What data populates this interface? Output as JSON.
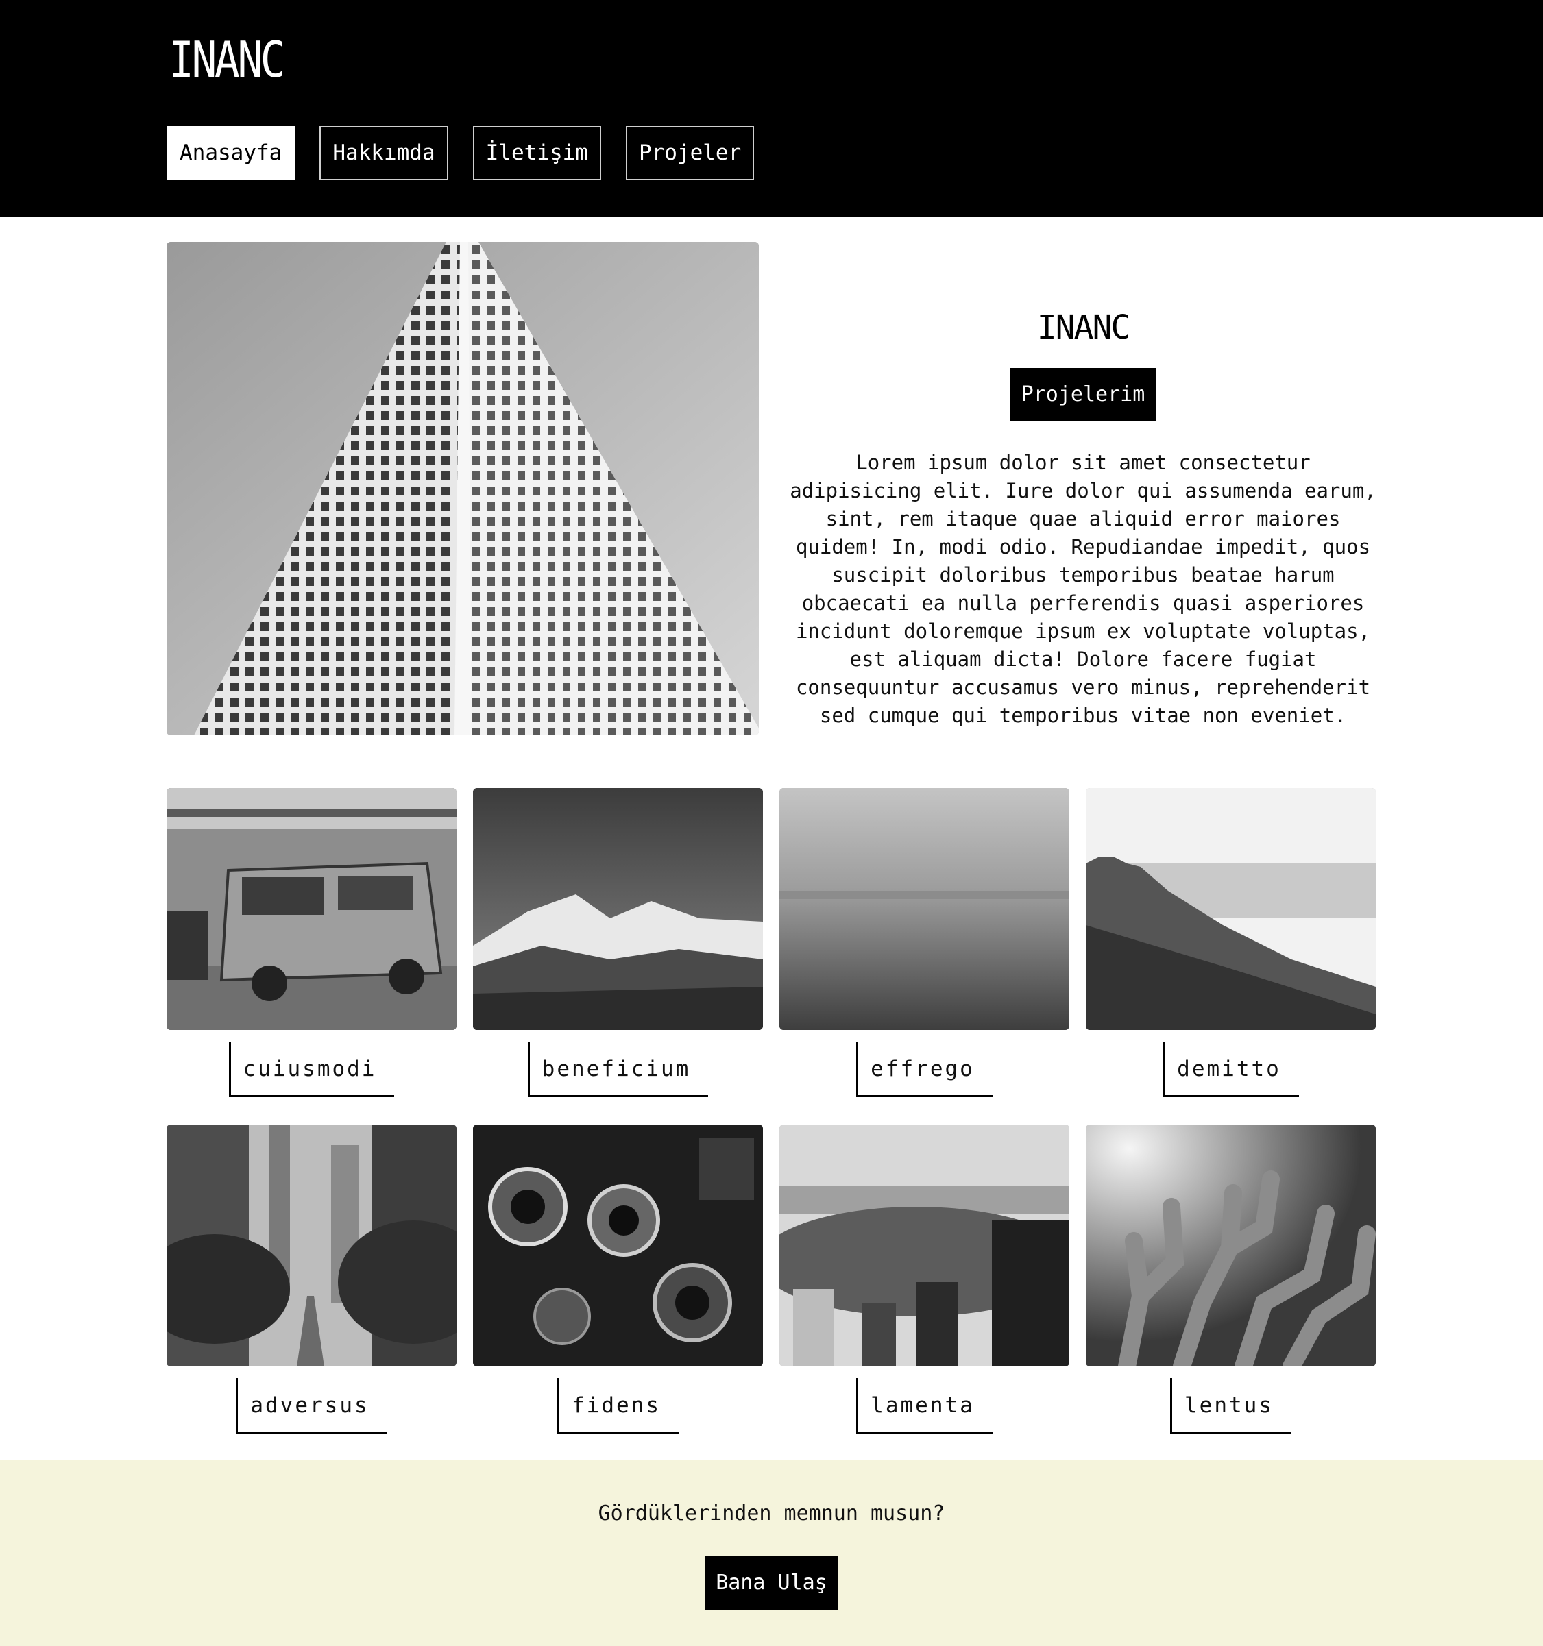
{
  "header": {
    "logo": "INANC",
    "nav": [
      {
        "label": "Anasayfa",
        "active": true
      },
      {
        "label": "Hakkımda",
        "active": false
      },
      {
        "label": "İletişim",
        "active": false
      },
      {
        "label": "Projeler",
        "active": false
      }
    ]
  },
  "hero": {
    "title": "INANC",
    "button_label": "Projelerim",
    "text": "Lorem ipsum dolor sit amet consectetur adipisicing elit. Iure dolor qui assumenda earum, sint, rem itaque quae aliquid error maiores quidem! In, modi odio. Repudiandae impedit, quos suscipit doloribus temporibus beatae harum obcaecati ea nulla perferendis quasi asperiores incidunt doloremque ipsum ex voluptate voluptas, est aliquam dicta! Dolore facere fugiat consequuntur accusamus vero minus, reprehenderit sed cumque qui temporibus vitae non eveniet."
  },
  "gallery": [
    {
      "label": "cuiusmodi",
      "image": "vw-van-photo"
    },
    {
      "label": "beneficium",
      "image": "mountain-photo"
    },
    {
      "label": "effrego",
      "image": "sea-photo"
    },
    {
      "label": "demitto",
      "image": "cloud-peak-photo"
    },
    {
      "label": "adversus",
      "image": "city-street-photo"
    },
    {
      "label": "fidens",
      "image": "cameras-photo"
    },
    {
      "label": "lamenta",
      "image": "city-park-photo"
    },
    {
      "label": "lentus",
      "image": "cactus-photo"
    }
  ],
  "footer": {
    "text": "Gördüklerinden memnun musun?",
    "button_label": "Bana Ulaş"
  }
}
